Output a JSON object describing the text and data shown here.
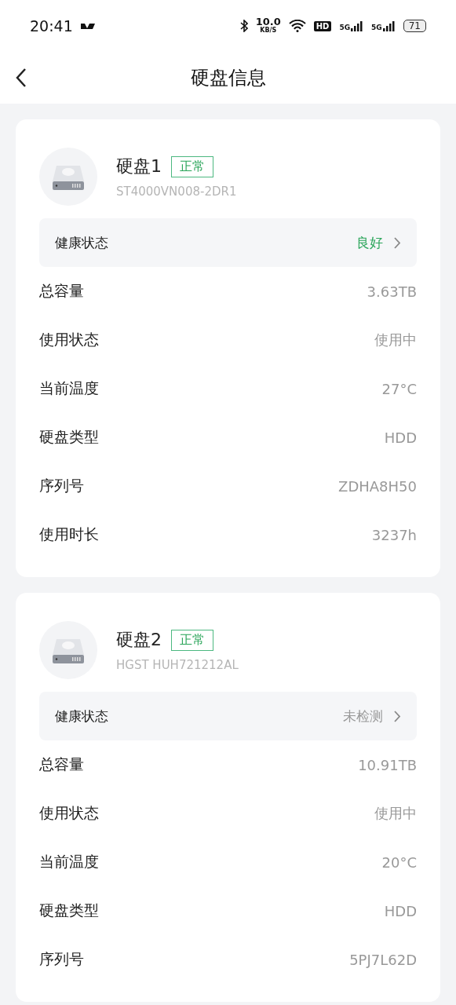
{
  "status_bar": {
    "time": "20:41",
    "speed": "10.0",
    "speed_unit": "KB/S",
    "hd": "HD",
    "signals": [
      "5G",
      "5G"
    ],
    "battery": "71"
  },
  "header": {
    "title": "硬盘信息"
  },
  "disks": [
    {
      "name": "硬盘1",
      "tag": "正常",
      "model": "ST4000VN008-2DR1",
      "health": {
        "label": "健康状态",
        "value": "良好",
        "color": "#2ba55a"
      },
      "rows": [
        {
          "label": "总容量",
          "value": "3.63TB"
        },
        {
          "label": "使用状态",
          "value": "使用中"
        },
        {
          "label": "当前温度",
          "value": "27°C"
        },
        {
          "label": "硬盘类型",
          "value": "HDD"
        },
        {
          "label": "序列号",
          "value": "ZDHA8H50"
        },
        {
          "label": "使用时长",
          "value": "3237h"
        }
      ]
    },
    {
      "name": "硬盘2",
      "tag": "正常",
      "model": "HGST HUH721212AL",
      "health": {
        "label": "健康状态",
        "value": "未检测",
        "color": "#999999"
      },
      "rows": [
        {
          "label": "总容量",
          "value": "10.91TB"
        },
        {
          "label": "使用状态",
          "value": "使用中"
        },
        {
          "label": "当前温度",
          "value": "20°C"
        },
        {
          "label": "硬盘类型",
          "value": "HDD"
        },
        {
          "label": "序列号",
          "value": "5PJ7L62D"
        }
      ]
    }
  ]
}
